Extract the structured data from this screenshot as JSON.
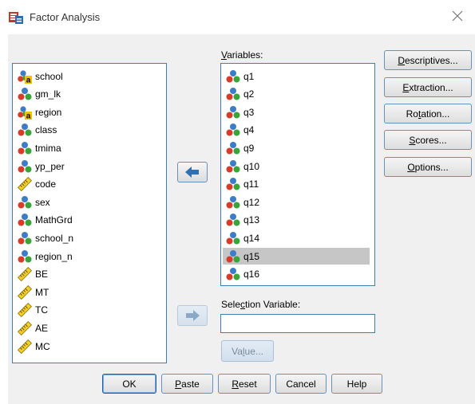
{
  "window": {
    "title": "Factor Analysis",
    "close_glyph": "✕"
  },
  "source_list": {
    "items": [
      {
        "label": "school",
        "icon": "nominal-string-icon"
      },
      {
        "label": "gm_lk",
        "icon": "nominal-icon"
      },
      {
        "label": "region",
        "icon": "nominal-string-icon"
      },
      {
        "label": "class",
        "icon": "nominal-icon"
      },
      {
        "label": "tmima",
        "icon": "nominal-icon"
      },
      {
        "label": "yp_per",
        "icon": "nominal-icon"
      },
      {
        "label": "code",
        "icon": "scale-ruler-icon"
      },
      {
        "label": "sex",
        "icon": "nominal-icon"
      },
      {
        "label": "MathGrd",
        "icon": "nominal-icon"
      },
      {
        "label": "school_n",
        "icon": "nominal-icon"
      },
      {
        "label": "region_n",
        "icon": "nominal-icon"
      },
      {
        "label": "BE",
        "icon": "scale-ruler-icon"
      },
      {
        "label": "MT",
        "icon": "scale-ruler-icon"
      },
      {
        "label": "TC",
        "icon": "scale-ruler-icon"
      },
      {
        "label": "AE",
        "icon": "scale-ruler-icon"
      },
      {
        "label": "MC",
        "icon": "scale-ruler-icon"
      }
    ]
  },
  "variables": {
    "label_prefix": "",
    "label_mnemonic": "V",
    "label_rest": "ariables:",
    "items": [
      {
        "label": "q1",
        "selected": false
      },
      {
        "label": "q2",
        "selected": false
      },
      {
        "label": "q3",
        "selected": false
      },
      {
        "label": "q4",
        "selected": false
      },
      {
        "label": "q9",
        "selected": false
      },
      {
        "label": "q10",
        "selected": false
      },
      {
        "label": "q11",
        "selected": false
      },
      {
        "label": "q12",
        "selected": false
      },
      {
        "label": "q13",
        "selected": false
      },
      {
        "label": "q14",
        "selected": false
      },
      {
        "label": "q15",
        "selected": true
      },
      {
        "label": "q16",
        "selected": false
      }
    ]
  },
  "selection_variable": {
    "label_prefix": "Sele",
    "label_mnemonic": "c",
    "label_rest": "tion Variable:",
    "value": ""
  },
  "side_buttons": {
    "descriptives": {
      "prefix": "",
      "mnemonic": "D",
      "rest": "escriptives..."
    },
    "extraction": {
      "prefix": "",
      "mnemonic": "E",
      "rest": "xtraction..."
    },
    "rotation": {
      "prefix": "Ro",
      "mnemonic": "t",
      "rest": "ation..."
    },
    "scores": {
      "prefix": "",
      "mnemonic": "S",
      "rest": "cores..."
    },
    "options": {
      "prefix": "",
      "mnemonic": "O",
      "rest": "ptions..."
    }
  },
  "value_button": {
    "prefix": "Va",
    "mnemonic": "l",
    "rest": "ue..."
  },
  "bottom_buttons": {
    "ok": {
      "prefix": "OK",
      "mnemonic": "",
      "rest": ""
    },
    "paste": {
      "prefix": "",
      "mnemonic": "P",
      "rest": "aste"
    },
    "reset": {
      "prefix": "",
      "mnemonic": "R",
      "rest": "eset"
    },
    "cancel": {
      "prefix": "Cancel",
      "mnemonic": "",
      "rest": ""
    },
    "help": {
      "prefix": "Help",
      "mnemonic": "",
      "rest": ""
    }
  },
  "colors": {
    "listbox_border": "#3c7fb1",
    "arrow_blue": "#2f6fb3",
    "selected_row": "#c6c6c6"
  }
}
